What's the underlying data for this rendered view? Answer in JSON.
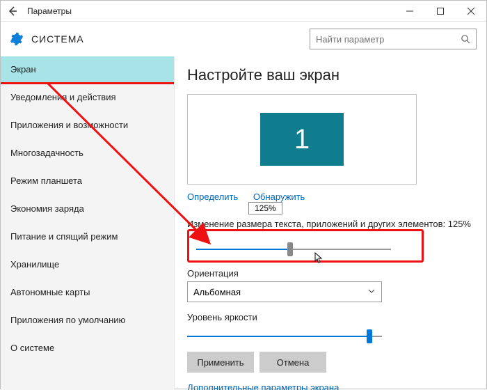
{
  "window": {
    "title": "Параметры"
  },
  "header": {
    "system_label": "СИСТЕМА",
    "search_placeholder": "Найти параметр"
  },
  "sidebar": {
    "items": [
      "Экран",
      "Уведомления и действия",
      "Приложения и возможности",
      "Многозадачность",
      "Режим планшета",
      "Экономия заряда",
      "Питание и спящий режим",
      "Хранилище",
      "Автономные карты",
      "Приложения по умолчанию",
      "О системе"
    ],
    "active_index": 0
  },
  "main": {
    "heading": "Настройте ваш экран",
    "monitor_id": "1",
    "link_identify": "Определить",
    "link_detect": "Обнаружить",
    "scale_tooltip": "125%",
    "scale_label": "Изменение размера текста, приложений и других элементов: 125%",
    "orientation_label": "Ориентация",
    "orientation_value": "Альбомная",
    "brightness_label": "Уровень яркости",
    "apply_btn": "Применить",
    "cancel_btn": "Отмена",
    "advanced_link": "Дополнительные параметры экрана"
  }
}
